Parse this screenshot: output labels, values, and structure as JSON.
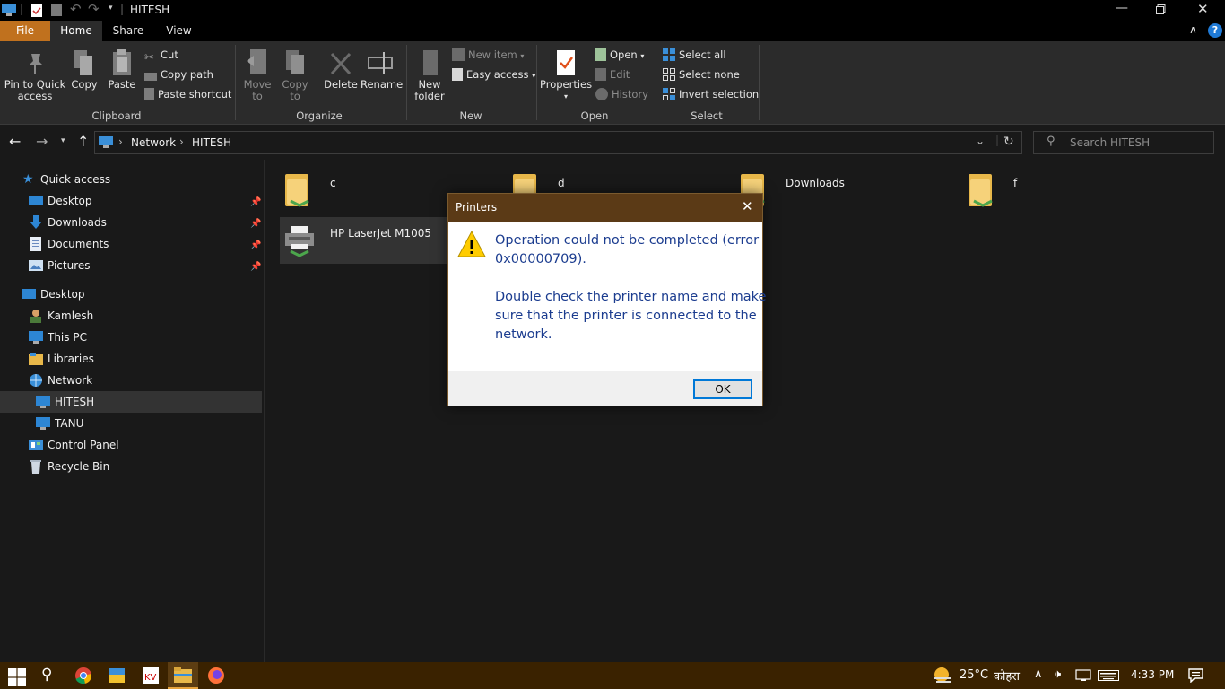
{
  "window": {
    "title": "HITESH",
    "controls": [
      "minimize-icon",
      "maximize-icon",
      "close-icon"
    ]
  },
  "tabs": {
    "file": "File",
    "home": "Home",
    "share": "Share",
    "view": "View"
  },
  "ribbon": {
    "clipboard": {
      "pin_line1": "Pin to Quick",
      "pin_line2": "access",
      "copy": "Copy",
      "paste": "Paste",
      "cut": "Cut",
      "copy_path": "Copy path",
      "paste_shortcut": "Paste shortcut",
      "label": "Clipboard"
    },
    "organize": {
      "move_line1": "Move",
      "move_line2": "to",
      "copy_line1": "Copy",
      "copy_line2": "to",
      "delete": "Delete",
      "rename": "Rename",
      "label": "Organize"
    },
    "new": {
      "folder_line1": "New",
      "folder_line2": "folder",
      "new_item": "New item",
      "easy_access": "Easy access",
      "label": "New"
    },
    "open": {
      "properties": "Properties",
      "open": "Open",
      "edit": "Edit",
      "history": "History",
      "label": "Open"
    },
    "select": {
      "select_all": "Select all",
      "select_none": "Select none",
      "invert": "Invert selection",
      "label": "Select"
    }
  },
  "address": {
    "crumbs": [
      "Network",
      "HITESH"
    ],
    "search_placeholder": "Search HITESH"
  },
  "nav": {
    "quick_access": "Quick access",
    "quick_items": [
      "Desktop",
      "Downloads",
      "Documents",
      "Pictures"
    ],
    "desktop": "Desktop",
    "items": [
      "Kamlesh",
      "This PC",
      "Libraries",
      "Network",
      "HITESH",
      "TANU",
      "Control Panel",
      "Recycle Bin"
    ]
  },
  "content": {
    "shares": [
      "c",
      "d",
      "Downloads",
      "f"
    ],
    "printer": "HP LaserJet M1005"
  },
  "dialog": {
    "title": "Printers",
    "line1": "Operation could not be completed (error",
    "line2": "0x00000709).",
    "line3": "Double check the printer name and make",
    "line4": "sure that the printer is connected to the",
    "line5": "network.",
    "ok": "OK"
  },
  "taskbar": {
    "weather": "25°C",
    "weather_text": "कोहरा",
    "time": "4:33 PM"
  },
  "colors": {
    "file_tab": "#c0711e",
    "taskbar": "#3a2200",
    "dialog_title": "#5b3a16",
    "message_text": "#1b3c8f"
  }
}
